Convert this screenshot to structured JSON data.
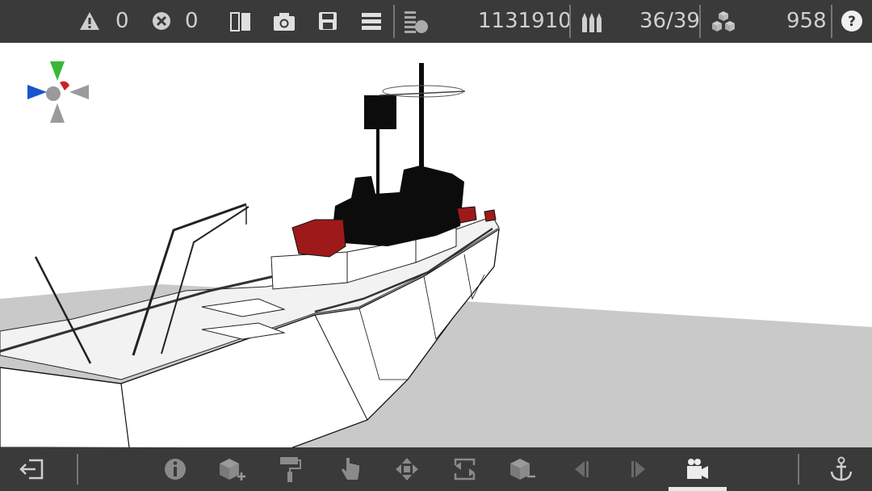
{
  "top_toolbar": {
    "warnings_count": "0",
    "errors_count": "0",
    "polygon_count": "1131910",
    "ammo_count": "36/39",
    "parts_count": "958"
  },
  "bottom_toolbar": {
    "active_tool": "camera-mode"
  },
  "colors": {
    "bar_bg": "#3a3a3a",
    "icon": "#d0d0d0",
    "floor": "#c9c9c9",
    "highlight_red": "#9e1a1a"
  }
}
